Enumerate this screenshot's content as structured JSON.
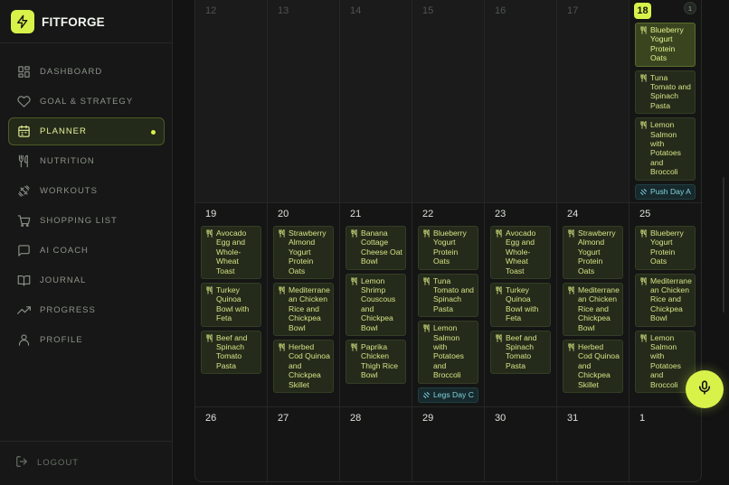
{
  "brand": {
    "name": "FITFORGE"
  },
  "nav": [
    {
      "label": "DASHBOARD",
      "icon": "dashboard-icon"
    },
    {
      "label": "GOAL & STRATEGY",
      "icon": "heart-icon"
    },
    {
      "label": "PLANNER",
      "icon": "calendar-icon",
      "active": true
    },
    {
      "label": "NUTRITION",
      "icon": "fork-knife-icon"
    },
    {
      "label": "WORKOUTS",
      "icon": "dumbbell-icon"
    },
    {
      "label": "SHOPPING LIST",
      "icon": "cart-icon"
    },
    {
      "label": "AI COACH",
      "icon": "chat-icon"
    },
    {
      "label": "JOURNAL",
      "icon": "book-icon"
    },
    {
      "label": "PROGRESS",
      "icon": "trend-icon"
    },
    {
      "label": "PROFILE",
      "icon": "user-icon"
    }
  ],
  "logout": {
    "label": "LOGOUT"
  },
  "colors": {
    "accent": "#d8f24a",
    "workout": "#7fd3e0"
  },
  "calendar": {
    "weeks": [
      [
        {
          "n": "12",
          "dim": true
        },
        {
          "n": "13",
          "dim": true
        },
        {
          "n": "14",
          "dim": true
        },
        {
          "n": "15",
          "dim": true
        },
        {
          "n": "16",
          "dim": true
        },
        {
          "n": "17",
          "dim": true
        },
        {
          "n": "18",
          "today": true,
          "badge": "1",
          "meals": [
            "Blueberry Yogurt Protein Oats",
            "Tuna Tomato and Spinach Pasta",
            "Lemon Salmon with Potatoes and Broccoli"
          ],
          "highlight": 0,
          "workout": "Push Day A"
        }
      ],
      [
        {
          "n": "19",
          "meals": [
            "Avocado Egg and Whole-Wheat Toast",
            "Turkey Quinoa Bowl with Feta",
            "Beef and Spinach Tomato Pasta"
          ]
        },
        {
          "n": "20",
          "meals": [
            "Strawberry Almond Yogurt Protein Oats",
            "Mediterranean Chicken Rice and Chickpea Bowl",
            "Herbed Cod Quinoa and Chickpea Skillet"
          ]
        },
        {
          "n": "21",
          "meals": [
            "Banana Cottage Cheese Oat Bowl",
            "Lemon Shrimp Couscous and Chickpea Bowl",
            "Paprika Chicken Thigh Rice Bowl"
          ]
        },
        {
          "n": "22",
          "meals": [
            "Blueberry Yogurt Protein Oats",
            "Tuna Tomato and Spinach Pasta",
            "Lemon Salmon with Potatoes and Broccoli"
          ],
          "workout": "Legs Day C"
        },
        {
          "n": "23",
          "meals": [
            "Avocado Egg and Whole-Wheat Toast",
            "Turkey Quinoa Bowl with Feta",
            "Beef and Spinach Tomato Pasta"
          ]
        },
        {
          "n": "24",
          "meals": [
            "Strawberry Almond Yogurt Protein Oats",
            "Mediterranean Chicken Rice and Chickpea Bowl",
            "Herbed Cod Quinoa and Chickpea Skillet"
          ]
        },
        {
          "n": "25",
          "meals": [
            "Blueberry Yogurt Protein Oats",
            "Mediterranean Chicken Rice and Chickpea Bowl",
            "Lemon Salmon with Potatoes and Broccoli"
          ]
        }
      ],
      [
        {
          "n": "26"
        },
        {
          "n": "27"
        },
        {
          "n": "28"
        },
        {
          "n": "29"
        },
        {
          "n": "30"
        },
        {
          "n": "31"
        },
        {
          "n": "1"
        }
      ]
    ]
  },
  "mic": {
    "icon": "microphone-icon"
  }
}
